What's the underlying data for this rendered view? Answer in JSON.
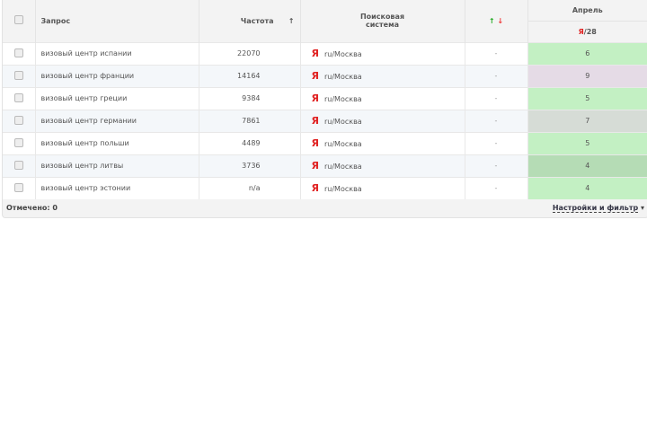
{
  "header": {
    "query": "Запрос",
    "frequency": "Частота",
    "sort_arrow": "↑",
    "engine": "Поисковая система",
    "up": "↑",
    "down": "↓",
    "month": "Апрель",
    "engine_short": "Я",
    "pos_total": "/28"
  },
  "rows": [
    {
      "query": "визовый центр испании",
      "freq": "22070",
      "engine": "Я",
      "region": "ru/Москва",
      "change": "-",
      "pos": "6",
      "color": "#c3f0c3"
    },
    {
      "query": "визовый центр франции",
      "freq": "14164",
      "engine": "Я",
      "region": "ru/Москва",
      "change": "-",
      "pos": "9",
      "color": "#e5dbe6"
    },
    {
      "query": "визовый центр греции",
      "freq": "9384",
      "engine": "Я",
      "region": "ru/Москва",
      "change": "-",
      "pos": "5",
      "color": "#c3f0c3"
    },
    {
      "query": "визовый центр германии",
      "freq": "7861",
      "engine": "Я",
      "region": "ru/Москва",
      "change": "-",
      "pos": "7",
      "color": "#d6dcd6"
    },
    {
      "query": "визовый центр польши",
      "freq": "4489",
      "engine": "Я",
      "region": "ru/Москва",
      "change": "-",
      "pos": "5",
      "color": "#c3f0c3"
    },
    {
      "query": "визовый центр литвы",
      "freq": "3736",
      "engine": "Я",
      "region": "ru/Москва",
      "change": "-",
      "pos": "4",
      "color": "#b5dcb5"
    },
    {
      "query": "визовый центр эстонии",
      "freq": "n/a",
      "engine": "Я",
      "region": "ru/Москва",
      "change": "-",
      "pos": "4",
      "color": "#c3f0c3"
    }
  ],
  "footer": {
    "checked": "Отмечено: 0",
    "settings": "Настройки и фильтр",
    "arrow": "▾"
  }
}
